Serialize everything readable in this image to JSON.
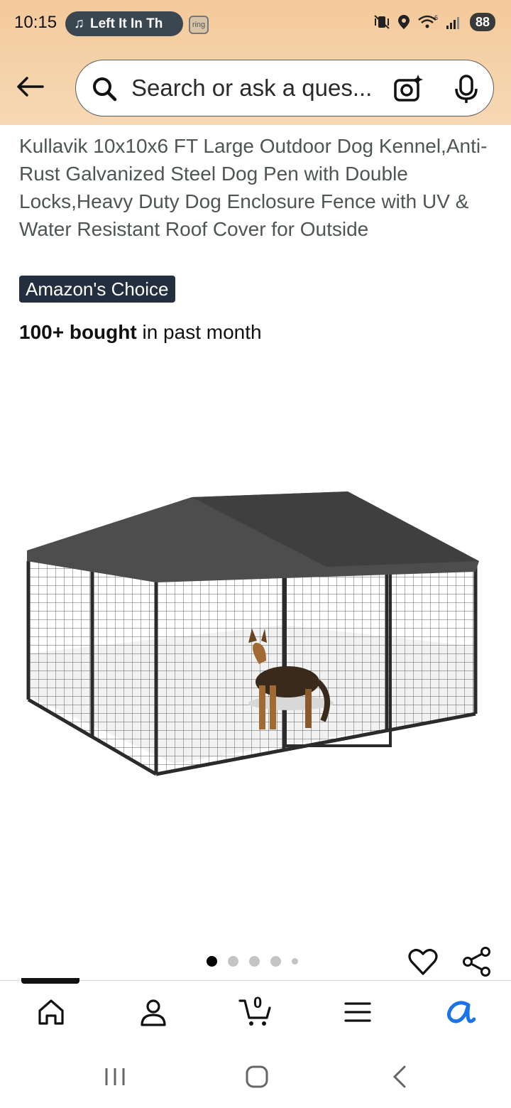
{
  "status_bar": {
    "time": "10:15",
    "media_text": "Left It In Th",
    "ring_label": "ring",
    "battery": "88",
    "wifi_superscript": "6"
  },
  "search": {
    "placeholder": "Search or ask a ques..."
  },
  "product": {
    "title": "Kullavik 10x10x6 FT Large Outdoor Dog Kennel,Anti-Rust Galvanized Steel Dog Pen with Double Locks,Heavy Duty Dog Enclosure Fence with UV & Water Resistant Roof Cover for Outside",
    "badge": "Amazon's Choice",
    "bought_bold": "100+ bought",
    "bought_rest": " in past month"
  },
  "carousel": {
    "count": 5,
    "active_index": 0
  },
  "bottom_nav": {
    "cart_count": "0",
    "items": [
      "home-icon",
      "account-icon",
      "cart-icon",
      "menu-icon",
      "rufus-icon"
    ],
    "active_index": 0
  },
  "colors": {
    "header_gradient_top": "#f3c99a",
    "badge_bg": "#232f3e",
    "rufus_blue": "#1a73e8"
  }
}
